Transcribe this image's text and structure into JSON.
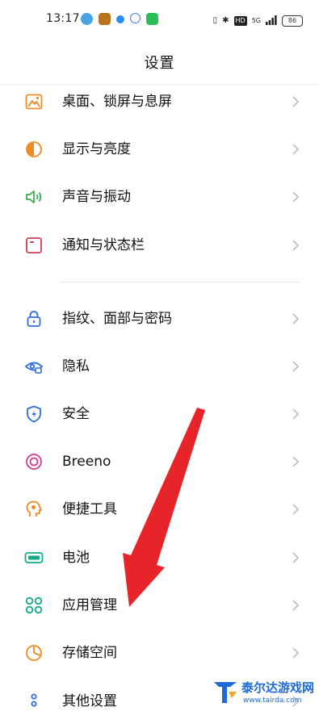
{
  "status_bar": {
    "time": "13:17",
    "network": "5G",
    "hd": "HD",
    "battery": "86"
  },
  "header": {
    "title": "设置"
  },
  "groups": [
    {
      "items": [
        {
          "label": "桌面、锁屏与息屏",
          "icon": "wallpaper-icon",
          "color": "#f08a24"
        },
        {
          "label": "显示与亮度",
          "icon": "brightness-icon",
          "color": "#f08a24"
        },
        {
          "label": "声音与振动",
          "icon": "speaker-icon",
          "color": "#3dab4f"
        },
        {
          "label": "通知与状态栏",
          "icon": "notification-icon",
          "color": "#d23b52"
        }
      ]
    },
    {
      "items": [
        {
          "label": "指纹、面部与密码",
          "icon": "lock-icon",
          "color": "#2f6ee0"
        },
        {
          "label": "隐私",
          "icon": "privacy-eye-icon",
          "color": "#2f6ee0"
        },
        {
          "label": "安全",
          "icon": "shield-icon",
          "color": "#2f6ee0"
        },
        {
          "label": "Breeno",
          "icon": "breeno-icon",
          "color": "#d63c8a"
        },
        {
          "label": "便捷工具",
          "icon": "tools-icon",
          "color": "#f08a24"
        },
        {
          "label": "电池",
          "icon": "battery-icon",
          "color": "#16a98c"
        },
        {
          "label": "应用管理",
          "icon": "apps-grid-icon",
          "color": "#16a98c"
        },
        {
          "label": "存储空间",
          "icon": "storage-pie-icon",
          "color": "#f08a24"
        },
        {
          "label": "其他设置",
          "icon": "more-settings-icon",
          "color": "#2f6ee0"
        }
      ]
    }
  ],
  "watermark": {
    "name": "泰尔达游戏网",
    "url": "www.tairda.com"
  }
}
